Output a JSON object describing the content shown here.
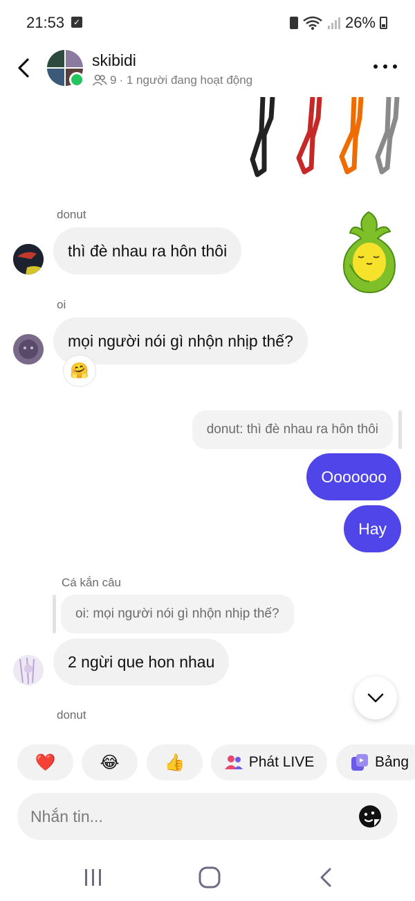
{
  "status_bar": {
    "time": "21:53",
    "battery": "26%"
  },
  "header": {
    "group_name": "skibidi",
    "member_count": "9",
    "active_text": "· 1 người đang hoạt động"
  },
  "messages": {
    "msg1": {
      "sender": "donut",
      "text": "thì đè nhau ra hôn thôi"
    },
    "msg2": {
      "sender": "oi",
      "text": "mọi người nói gì nhộn nhịp thế?",
      "reaction": "🤗"
    },
    "msg3": {
      "reply_quote": "donut: thì đè nhau ra hôn thôi"
    },
    "msg4": {
      "text": "Ooooooo"
    },
    "msg5": {
      "text": "Hay"
    },
    "msg6": {
      "sender": "Cá kắn câu",
      "reply_quote": "oi: mọi người nói gì nhộn nhịp thế?",
      "text": "2 ngừi que hon nhau"
    },
    "msg7": {
      "sender": "donut"
    }
  },
  "quick_actions": [
    {
      "emoji": "❤️"
    },
    {
      "emoji": "😂"
    },
    {
      "emoji": "👍"
    },
    {
      "label": "Phát LIVE"
    },
    {
      "label": "Bảng"
    }
  ],
  "composer": {
    "placeholder": "Nhắn tin..."
  },
  "colors": {
    "accent": "#4f45e9",
    "online": "#22c55e",
    "bubble_in": "#f1f1f1"
  }
}
